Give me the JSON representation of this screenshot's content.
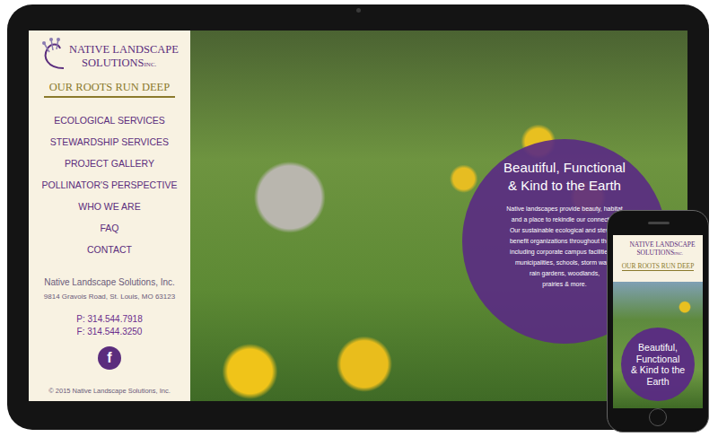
{
  "site": {
    "brand_line1": "NATIVE LANDSCAPE",
    "brand_line2": "SOLUTIONS",
    "brand_suffix": "INC.",
    "tagline": "OUR ROOTS RUN DEEP"
  },
  "nav": [
    "ECOLOGICAL SERVICES",
    "STEWARDSHIP SERVICES",
    "PROJECT GALLERY",
    "POLLINATOR'S PERSPECTIVE",
    "WHO WE ARE",
    "FAQ",
    "CONTACT"
  ],
  "contact": {
    "company": "Native Landscape Solutions, Inc.",
    "address": "9814 Gravois Road, St. Louis, MO 63123",
    "phone": "P: 314.544.7918",
    "fax": "F: 314.544.3250",
    "social": "f",
    "copyright": "© 2015 Native Landscape Solutions, Inc."
  },
  "hero": {
    "title_line1": "Beautiful, Functional",
    "title_line2": "& Kind to the Earth",
    "body": [
      "Native landscapes provide beauty, habitat",
      "and a place to rekindle our connection",
      "Our sustainable ecological and steward",
      "benefit organizations throughout the St.",
      "including corporate campus facilities, st",
      "municipalities, schools, storm water",
      "rain gardens, woodlands,",
      "prairies & more."
    ]
  },
  "phone": {
    "brand_line1": "NATIVE LANDSCAPE",
    "brand_line2": "SOLUTIONS",
    "brand_suffix": "INC.",
    "tagline": "OUR ROOTS RUN DEEP",
    "title": [
      "Beautiful,",
      "Functional",
      "& Kind to the",
      "Earth"
    ]
  }
}
